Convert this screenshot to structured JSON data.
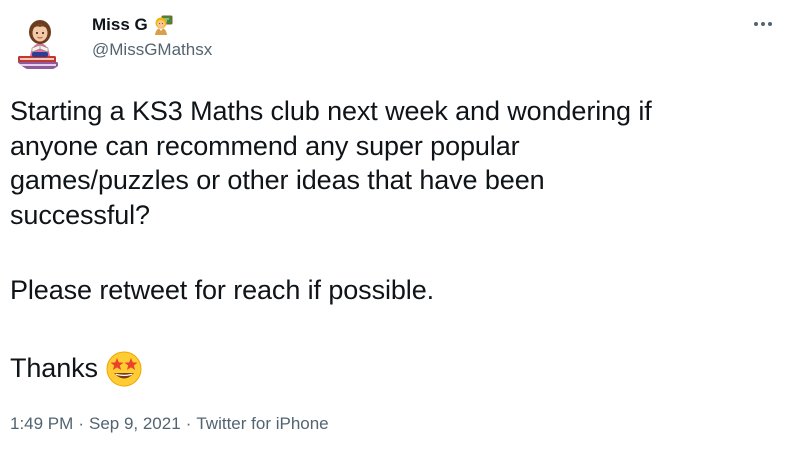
{
  "author": {
    "display_name": "Miss G",
    "handle": "@MissGMathsx",
    "name_emoji": "woman-teacher-emoji"
  },
  "tweet": {
    "paragraph_1_lines": [
      "Starting a KS3 Maths club next week and wondering if",
      "anyone can recommend any super popular",
      "games/puzzles or other ideas that have been",
      "successful?"
    ],
    "paragraph_2": "Please retweet for reach if possible.",
    "paragraph_3_text": "Thanks",
    "paragraph_3_emoji": "star-struck-emoji"
  },
  "meta": {
    "time": "1:49 PM",
    "separator": "·",
    "date": "Sep 9, 2021",
    "source": "Twitter for iPhone"
  },
  "icons": {
    "more": "more-horizontal-icon"
  },
  "colors": {
    "text_primary": "#0f1419",
    "text_secondary": "#536471",
    "background": "#ffffff"
  }
}
